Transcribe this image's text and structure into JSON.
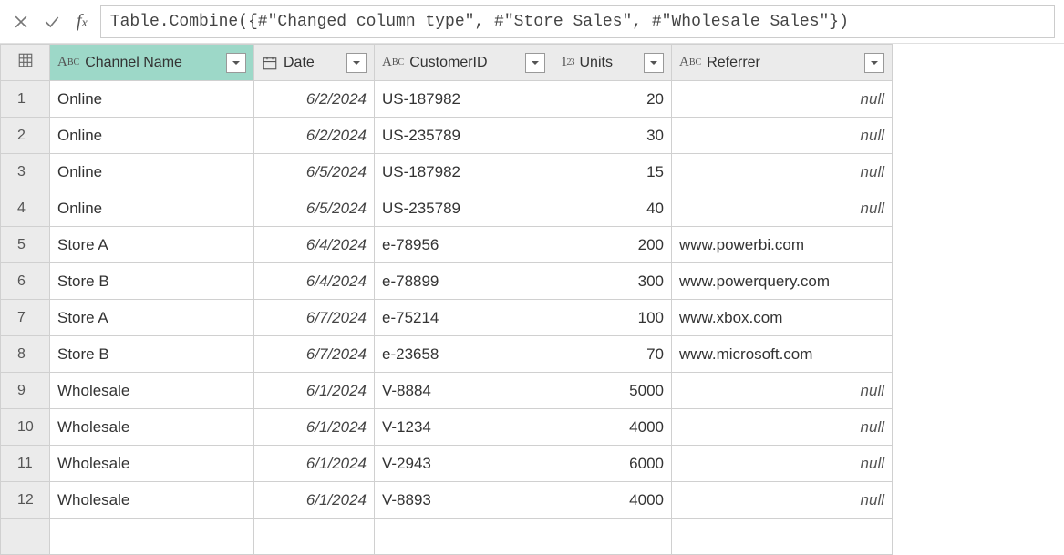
{
  "formula": "Table.Combine({#\"Changed column type\", #\"Store Sales\", #\"Wholesale Sales\"})",
  "columns": {
    "channel": {
      "label": "Channel Name",
      "type": "text",
      "selected": true
    },
    "date": {
      "label": "Date",
      "type": "date"
    },
    "customer": {
      "label": "CustomerID",
      "type": "text"
    },
    "units": {
      "label": "Units",
      "type": "number"
    },
    "referrer": {
      "label": "Referrer",
      "type": "text"
    }
  },
  "nullLabel": "null",
  "rows": [
    {
      "n": "1",
      "channel": "Online",
      "date": "6/2/2024",
      "customer": "US-187982",
      "units": "20",
      "referrer": null
    },
    {
      "n": "2",
      "channel": "Online",
      "date": "6/2/2024",
      "customer": "US-235789",
      "units": "30",
      "referrer": null
    },
    {
      "n": "3",
      "channel": "Online",
      "date": "6/5/2024",
      "customer": "US-187982",
      "units": "15",
      "referrer": null
    },
    {
      "n": "4",
      "channel": "Online",
      "date": "6/5/2024",
      "customer": "US-235789",
      "units": "40",
      "referrer": null
    },
    {
      "n": "5",
      "channel": "Store A",
      "date": "6/4/2024",
      "customer": "e-78956",
      "units": "200",
      "referrer": "www.powerbi.com"
    },
    {
      "n": "6",
      "channel": "Store B",
      "date": "6/4/2024",
      "customer": "e-78899",
      "units": "300",
      "referrer": "www.powerquery.com"
    },
    {
      "n": "7",
      "channel": "Store A",
      "date": "6/7/2024",
      "customer": "e-75214",
      "units": "100",
      "referrer": "www.xbox.com"
    },
    {
      "n": "8",
      "channel": "Store B",
      "date": "6/7/2024",
      "customer": "e-23658",
      "units": "70",
      "referrer": "www.microsoft.com"
    },
    {
      "n": "9",
      "channel": "Wholesale",
      "date": "6/1/2024",
      "customer": "V-8884",
      "units": "5000",
      "referrer": null
    },
    {
      "n": "10",
      "channel": "Wholesale",
      "date": "6/1/2024",
      "customer": "V-1234",
      "units": "4000",
      "referrer": null
    },
    {
      "n": "11",
      "channel": "Wholesale",
      "date": "6/1/2024",
      "customer": "V-2943",
      "units": "6000",
      "referrer": null
    },
    {
      "n": "12",
      "channel": "Wholesale",
      "date": "6/1/2024",
      "customer": "V-8893",
      "units": "4000",
      "referrer": null
    }
  ]
}
